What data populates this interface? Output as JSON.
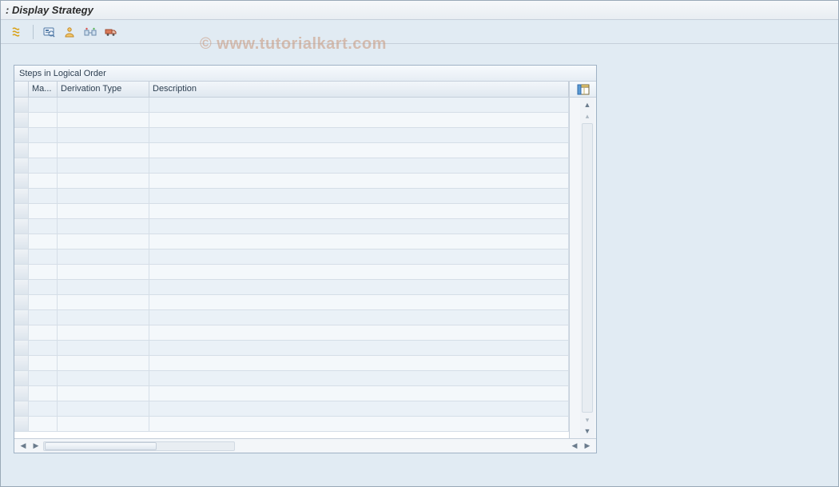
{
  "header": {
    "title": ": Display Strategy"
  },
  "toolbar": {
    "icons": [
      {
        "name": "edit-icon"
      },
      {
        "name": "overview-icon"
      },
      {
        "name": "user-icon"
      },
      {
        "name": "trace-icon"
      },
      {
        "name": "truck-icon"
      }
    ]
  },
  "panel": {
    "title": "Steps in Logical Order",
    "columns": {
      "sel": "",
      "ma": "Ma...",
      "derivation_type": "Derivation Type",
      "description": "Description"
    },
    "config_button": "table-settings-icon",
    "row_count": 22
  },
  "watermark": "© www.tutorialkart.com"
}
